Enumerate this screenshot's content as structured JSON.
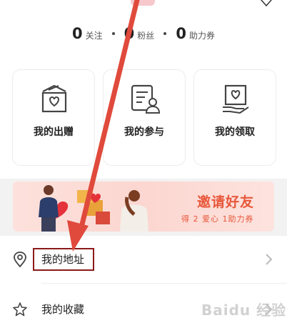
{
  "stats": [
    {
      "value": "0",
      "label": "关注"
    },
    {
      "value": "0",
      "label": "粉丝"
    },
    {
      "value": "0",
      "label": "助力券"
    }
  ],
  "cards": [
    {
      "label": "我的出赠",
      "icon": "gift-box-heart-icon"
    },
    {
      "label": "我的参与",
      "icon": "participation-document-user-icon"
    },
    {
      "label": "我的领取",
      "icon": "receive-heart-hand-icon"
    }
  ],
  "banner": {
    "title": "邀请好友",
    "subtitle": "得 2 爱心  1助力券"
  },
  "list": [
    {
      "label": "我的地址",
      "icon": "location-pin-icon"
    },
    {
      "label": "我的收藏",
      "icon": "star-icon"
    }
  ],
  "watermark": "Baidu 经验",
  "colors": {
    "accent": "#e8583b",
    "arrow": "#e04a3c",
    "highlight_border": "#8b1a1a"
  }
}
